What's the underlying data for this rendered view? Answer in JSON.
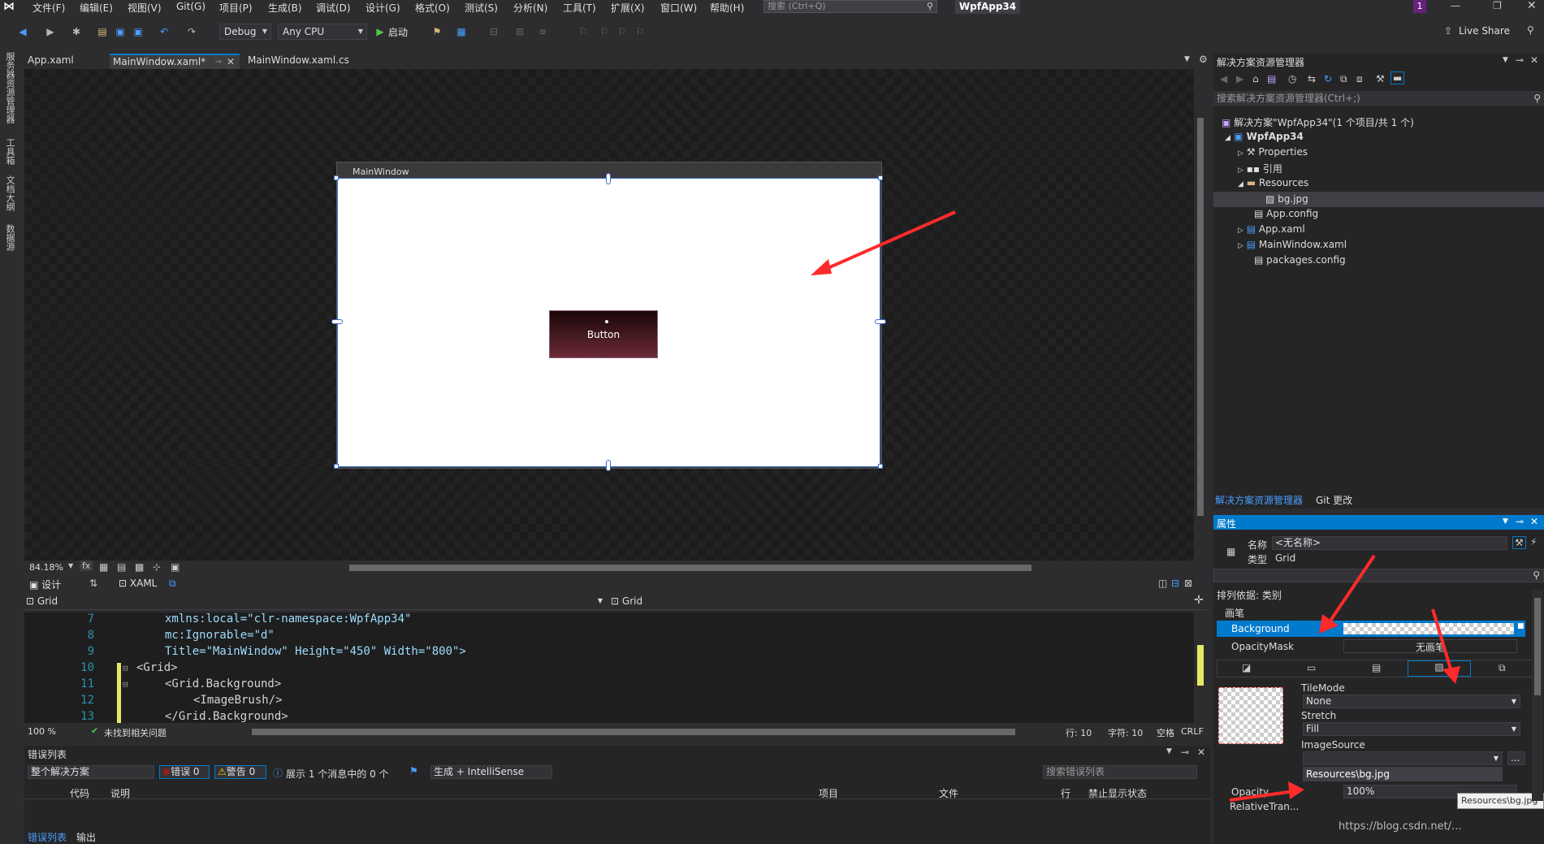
{
  "menu": {
    "items": [
      "文件(F)",
      "编辑(E)",
      "视图(V)",
      "Git(G)",
      "项目(P)",
      "生成(B)",
      "调试(D)",
      "设计(G)",
      "格式(O)",
      "测试(S)",
      "分析(N)",
      "工具(T)",
      "扩展(X)",
      "窗口(W)",
      "帮助(H)"
    ],
    "search_placeholder": "搜索 (Ctrl+Q)",
    "app_title": "WpfApp34",
    "notif": "1",
    "live_share": "Live Share"
  },
  "toolbar": {
    "config": "Debug",
    "platform": "Any CPU",
    "start": "启动"
  },
  "rail": {
    "items": [
      "服务器资源管理器",
      "工具箱",
      "文档大纲",
      "数据源"
    ]
  },
  "tabs": [
    {
      "label": "App.xaml"
    },
    {
      "label": "MainWindow.xaml*"
    },
    {
      "label": "MainWindow.xaml.cs"
    }
  ],
  "designer": {
    "window_title": "MainWindow",
    "button_label": "Button",
    "zoom": "84.18%"
  },
  "viewtabs": {
    "design": "设计",
    "xaml": "XAML",
    "swap": "⇅"
  },
  "scope": {
    "left": "Grid",
    "right": "Grid"
  },
  "xaml": {
    "lines": [
      {
        "n": "7",
        "text": "xmlns:local=\"clr-namespace:WpfApp34\""
      },
      {
        "n": "8",
        "text": "mc:Ignorable=\"d\""
      },
      {
        "n": "9",
        "text": "Title=\"MainWindow\" Height=\"450\" Width=\"800\">"
      },
      {
        "n": "10",
        "text": "<Grid>"
      },
      {
        "n": "11",
        "text": "<Grid.Background>"
      },
      {
        "n": "12",
        "text": "<ImageBrush/>"
      },
      {
        "n": "13",
        "text": "</Grid.Background>"
      }
    ]
  },
  "edstatus": {
    "zoom": "100 %",
    "issues": "未找到相关问题",
    "line": "行: 10",
    "char": "字符: 10",
    "spaces": "空格",
    "eol": "CRLF"
  },
  "errors": {
    "title": "错误列表",
    "scope": "整个解决方案",
    "errors": "错误 0",
    "warnings": "警告 0",
    "messages": "展示 1 个消息中的 0 个",
    "build": "生成 + IntelliSense",
    "search": "搜索错误列表",
    "columns": [
      "代码",
      "说明",
      "项目",
      "文件",
      "行",
      "禁止显示状态"
    ],
    "tab_errors": "错误列表",
    "tab_output": "输出"
  },
  "solex": {
    "title": "解决方案资源管理器",
    "search": "搜索解决方案资源管理器(Ctrl+;)",
    "tree": [
      {
        "label": "解决方案\"WpfApp34\"(1 个项目/共 1 个)"
      },
      {
        "label": "WpfApp34"
      },
      {
        "label": "Properties"
      },
      {
        "label": "引用"
      },
      {
        "label": "Resources"
      },
      {
        "label": "bg.jpg"
      },
      {
        "label": "App.config"
      },
      {
        "label": "App.xaml"
      },
      {
        "label": "MainWindow.xaml"
      },
      {
        "label": "packages.config"
      }
    ],
    "tab_solex": "解决方案资源管理器",
    "tab_git": "Git 更改"
  },
  "props": {
    "title": "属性",
    "name_label": "名称",
    "name_value": "<无名称>",
    "type_label": "类型",
    "type_value": "Grid",
    "sort": "排列依据: 类别",
    "category": "画笔",
    "background": "Background",
    "opacitymask": "OpacityMask",
    "nobrush": "无画笔",
    "tilemode_label": "TileMode",
    "tilemode": "None",
    "stretch_label": "Stretch",
    "stretch": "Fill",
    "imagesource_label": "ImageSource",
    "imagesource_option": "Resources\\bg.jpg",
    "browse": "...",
    "opacity_label": "Opacity",
    "opacity": "100%",
    "relative_label": "RelativeTran...",
    "tooltip": "Resources\\bg.jpg"
  },
  "watermark": "https://blog.csdn.net/..."
}
